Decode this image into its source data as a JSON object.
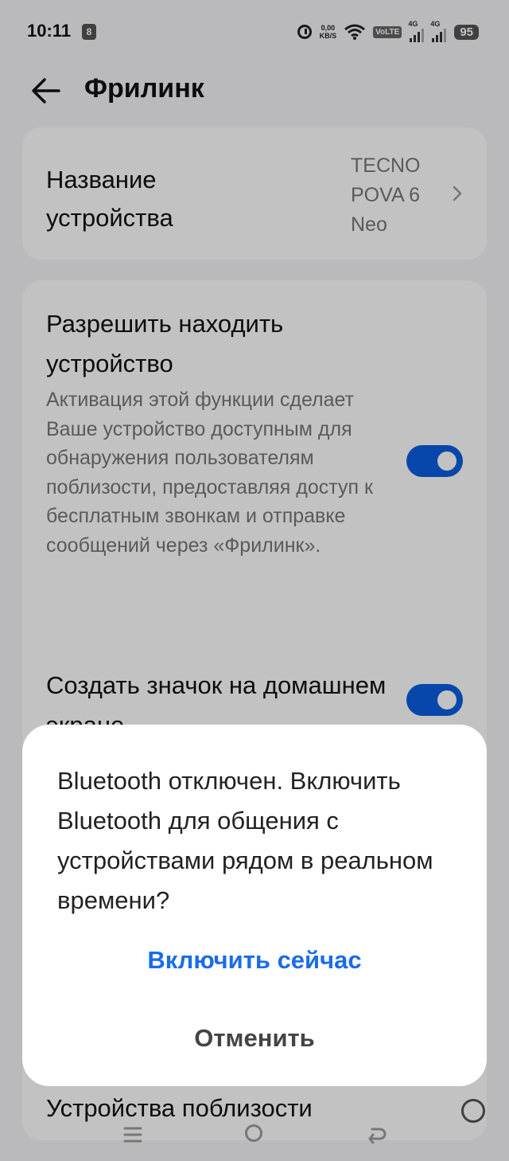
{
  "status_bar": {
    "time": "10:11",
    "badge": "8",
    "net_speed_value": "0,00",
    "net_speed_unit": "KB/S",
    "volte": "VoLTE",
    "sim1_label": "4G",
    "sim2_label": "4G",
    "battery": "95"
  },
  "header": {
    "title": "Фрилинк"
  },
  "device_card": {
    "label": "Название устройства",
    "value": "TECNO POVA 6 Neo"
  },
  "settings": {
    "allow_find_title": "Разрешить находить устройство",
    "allow_find_description": "Активация этой функции сделает Ваше устройство доступным для обнаружения пользователям поблизости, предоставляя доступ к бесплатным звонкам и отправке сообщений через «Фрилинк».",
    "allow_find_enabled": true,
    "home_icon_title": "Создать значок на домашнем экране",
    "home_icon_enabled": true,
    "nearby_devices_label": "Устройства поблизости"
  },
  "dialog": {
    "message": "Bluetooth отключен. Включить Bluetooth для общения с устройствами рядом в реальном времени?",
    "confirm_label": "Включить сейчас",
    "cancel_label": "Отменить"
  },
  "colors": {
    "accent": "#1a6ce8",
    "toggle_on": "#0a5ce0"
  }
}
